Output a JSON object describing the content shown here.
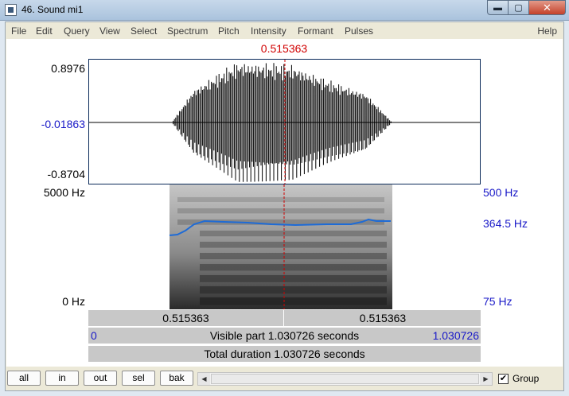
{
  "window": {
    "title": "46. Sound mi1"
  },
  "menu": [
    "File",
    "Edit",
    "Query",
    "View",
    "Select",
    "Spectrum",
    "Pitch",
    "Intensity",
    "Formant",
    "Pulses"
  ],
  "menu_help": "Help",
  "cursor_time": "0.515363",
  "waveform": {
    "max_label": "0.8976",
    "zero_label": "-0.01863",
    "min_label": "-0.8704"
  },
  "spectrogram": {
    "top_label": "5000 Hz",
    "bottom_label": "0 Hz"
  },
  "pitch": {
    "top_label": "500 Hz",
    "current_label": "364.5 Hz",
    "bottom_label": "75 Hz",
    "curve_color": "#1e6bd6"
  },
  "time_bars": {
    "left_segment": "0.515363",
    "right_segment": "0.515363",
    "visible_start": "0",
    "visible_text": "Visible part 1.030726 seconds",
    "visible_end": "1.030726",
    "total_text": "Total duration 1.030726 seconds"
  },
  "buttons": {
    "all": "all",
    "in": "in",
    "out": "out",
    "sel": "sel",
    "bak": "bak"
  },
  "group": {
    "label": "Group",
    "checked": true
  },
  "colors": {
    "cursor": "#d10000",
    "axis_blue": "#1919c8",
    "waveform": "#000000"
  },
  "icons": [
    "window-app-icon",
    "minimize-icon",
    "maximize-icon",
    "close-icon",
    "scroll-left-icon",
    "scroll-right-icon",
    "checkmark-icon"
  ]
}
